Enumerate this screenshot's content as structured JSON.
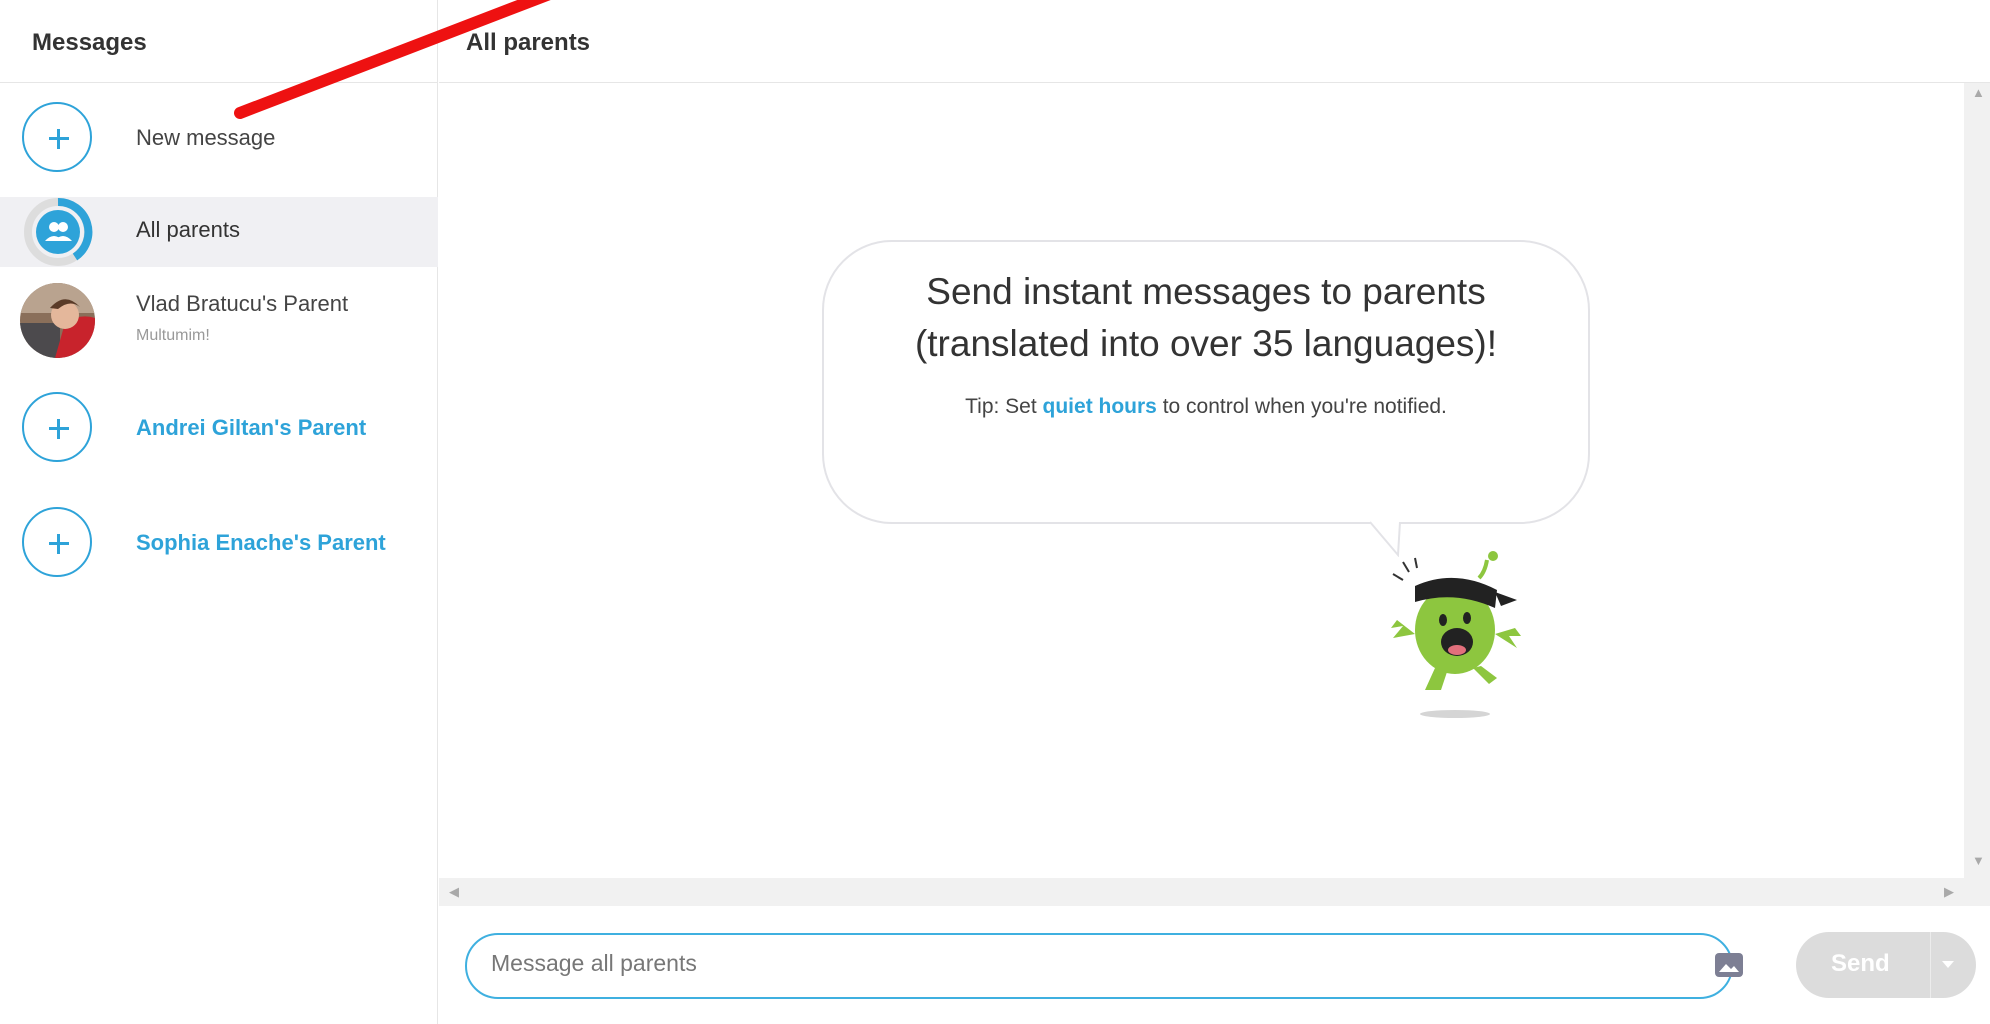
{
  "sidebar": {
    "title": "Messages",
    "items": [
      {
        "label": "New message",
        "icon": "plus-circle-icon"
      },
      {
        "label": "All parents",
        "icon": "group-icon",
        "selected": true
      },
      {
        "label": "Vlad Bratucu's Parent",
        "sub": "Multumim!",
        "icon": "avatar-photo"
      },
      {
        "label": "Andrei Giltan's Parent",
        "icon": "plus-circle-icon"
      },
      {
        "label": "Sophia Enache's Parent",
        "icon": "plus-circle-icon"
      }
    ]
  },
  "main": {
    "title": "All parents",
    "bubble": {
      "heading_line1": "Send instant messages to parents",
      "heading_line2": "(translated into over 35 languages)!",
      "tip_prefix": "Tip: Set ",
      "tip_link": "quiet hours",
      "tip_suffix": " to control when you're notified."
    }
  },
  "composer": {
    "placeholder": "Message all parents",
    "send_label": "Send"
  },
  "colors": {
    "accent": "#2ea3d9",
    "mascot_green": "#8dc63f",
    "annotation_red": "#ee1111"
  }
}
